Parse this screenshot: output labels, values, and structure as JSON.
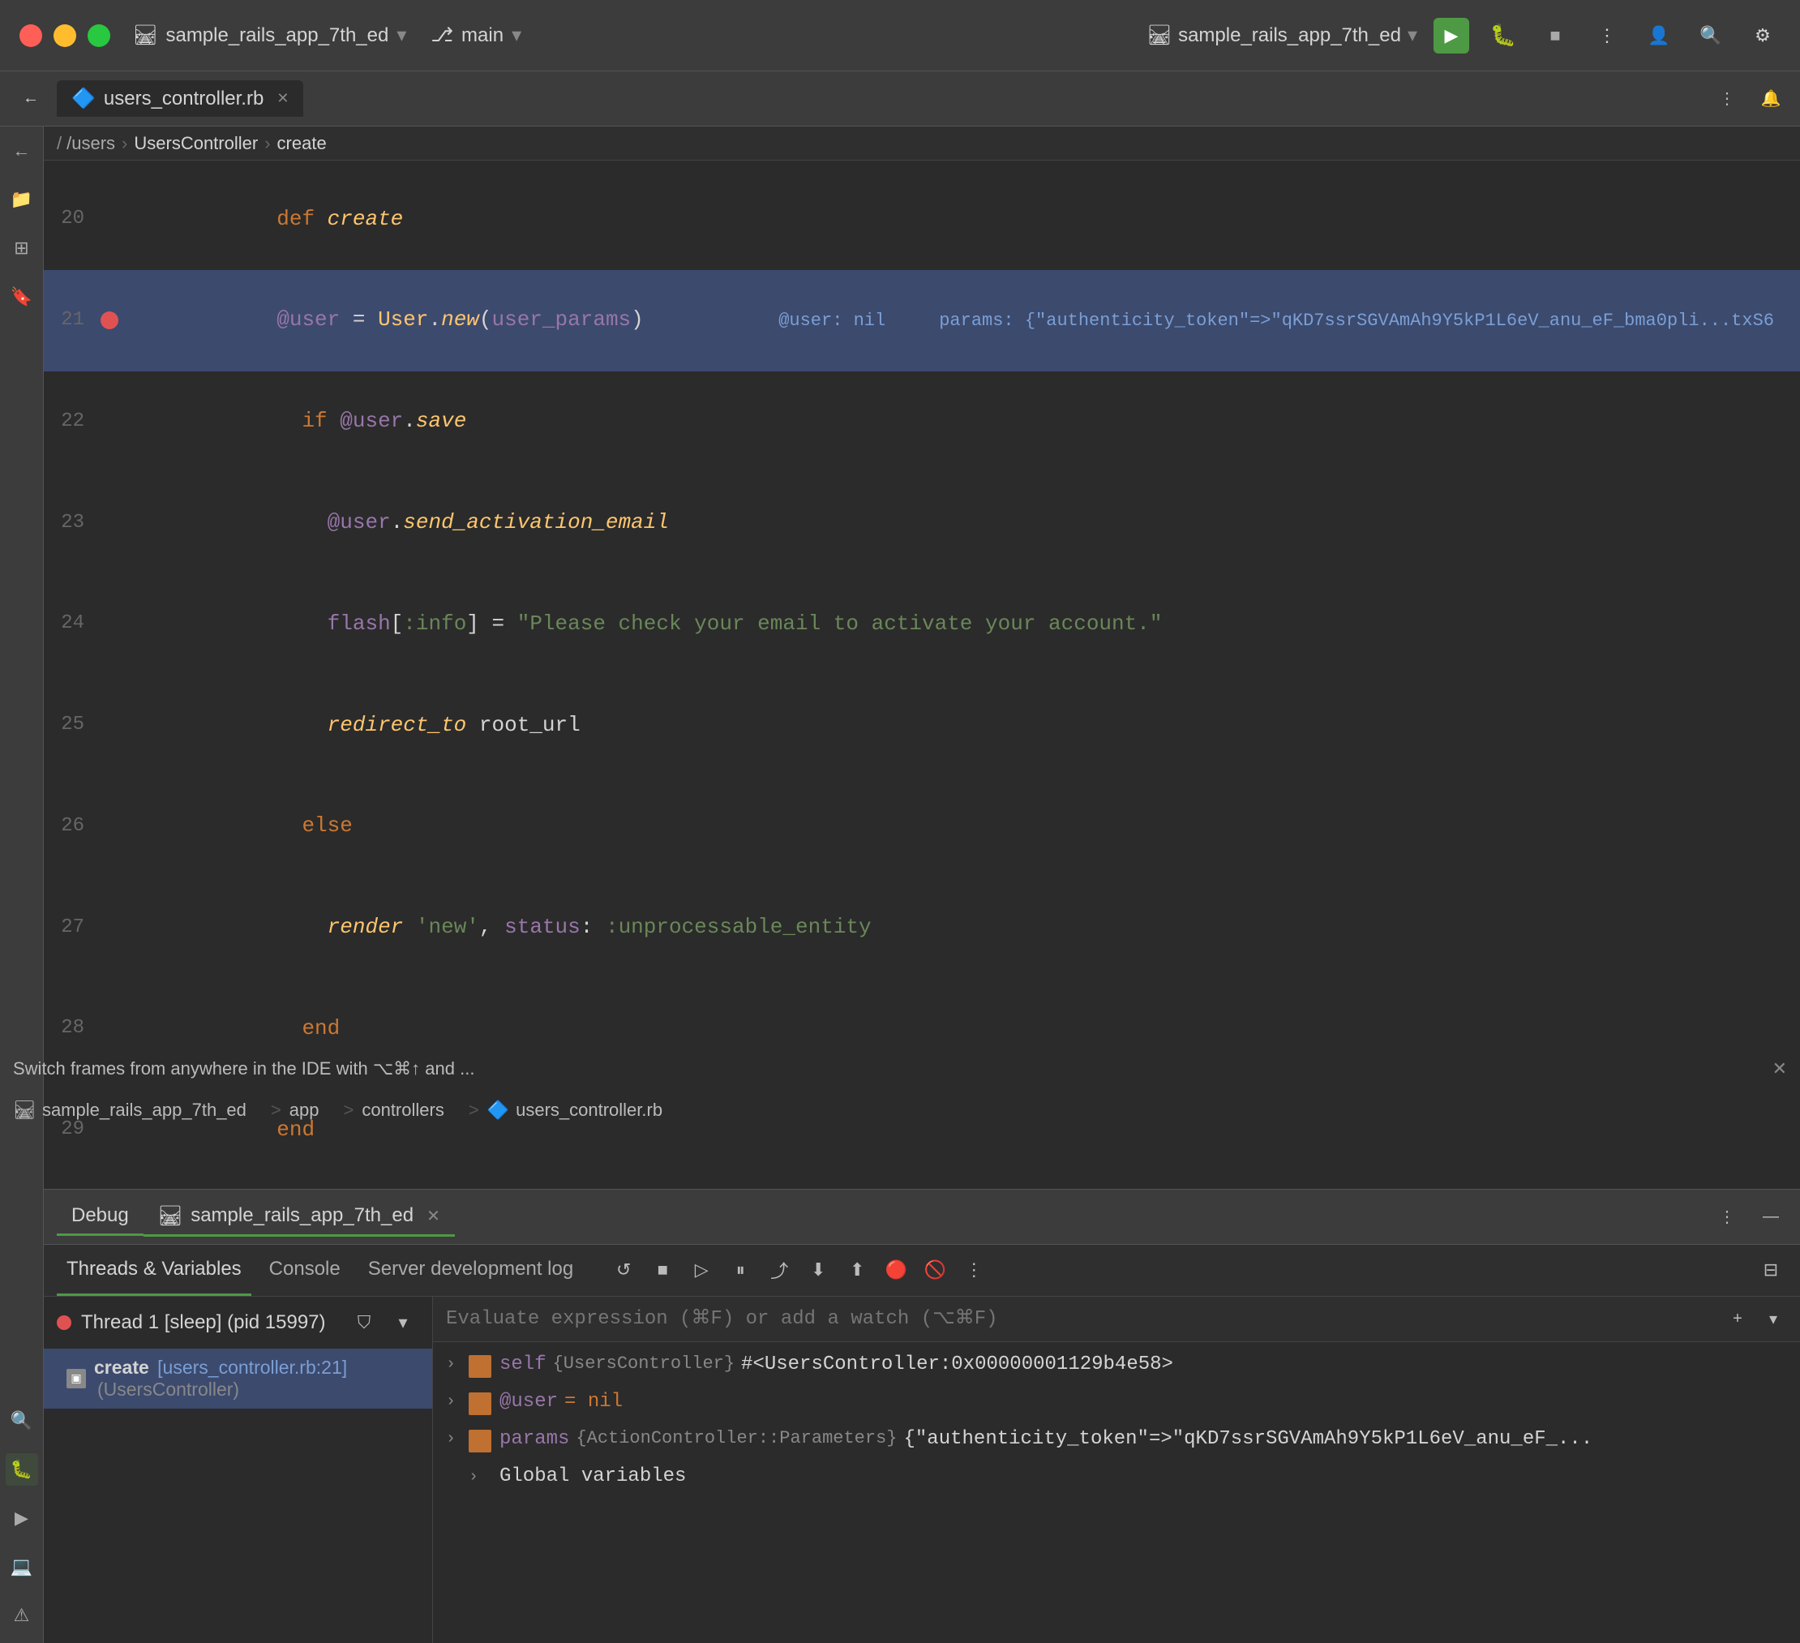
{
  "titlebar": {
    "project_name": "sample_rails_app_7th_ed",
    "branch": "main",
    "project_name_right": "sample_rails_app_7th_ed",
    "run_icon": "▶",
    "stop_icon": "■",
    "more_icon": "⋮",
    "user_icon": "👤",
    "search_icon": "🔍",
    "settings_icon": "⚙"
  },
  "tabs": [
    {
      "label": "users_controller.rb",
      "active": true,
      "closeable": true
    }
  ],
  "breadcrumb": {
    "path": "/users",
    "class": "UsersController",
    "method": "create"
  },
  "code_lines": [
    {
      "num": "20",
      "content": "def create",
      "breakpoint": false,
      "highlighted": false
    },
    {
      "num": "21",
      "content": "  @user = User.new(user_params)",
      "breakpoint": true,
      "highlighted": true,
      "debug_text": "@user: nil    params: {\"authenticity_token\"=>\"qKD7ssrSGVAmAh9Y5kP1L6eV_anu_eF_bma0pli...txS6"
    },
    {
      "num": "22",
      "content": "  if @user.save",
      "breakpoint": false,
      "highlighted": false
    },
    {
      "num": "23",
      "content": "    @user.send_activation_email",
      "breakpoint": false,
      "highlighted": false
    },
    {
      "num": "24",
      "content": "    flash[:info] = \"Please check your email to activate your account.\"",
      "breakpoint": false,
      "highlighted": false
    },
    {
      "num": "25",
      "content": "    redirect_to root_url",
      "breakpoint": false,
      "highlighted": false
    },
    {
      "num": "26",
      "content": "  else",
      "breakpoint": false,
      "highlighted": false
    },
    {
      "num": "27",
      "content": "    render 'new', status: :unprocessable_entity",
      "breakpoint": false,
      "highlighted": false
    },
    {
      "num": "28",
      "content": "  end",
      "breakpoint": false,
      "highlighted": false
    },
    {
      "num": "29",
      "content": "end",
      "breakpoint": false,
      "highlighted": false
    }
  ],
  "debug": {
    "tab_debug": "Debug",
    "tab_project": "sample_rails_app_7th_ed",
    "toolbar_buttons": [
      "↺",
      "■",
      "▷",
      "⏸",
      "⬆",
      "⬇",
      "⬆",
      "🔴",
      "🚫",
      "⋮"
    ],
    "threads_label": "Threads & Variables",
    "console_label": "Console",
    "server_log_label": "Server development log",
    "thread1": {
      "label": "Thread 1 [sleep] (pid 15997)"
    },
    "frame1": {
      "label": "create",
      "file": "[users_controller.rb:21]",
      "class": "(UsersController)"
    },
    "expression_placeholder": "Evaluate expression (⌘F) or add a watch (⌥⌘F)",
    "variables": [
      {
        "expand": true,
        "name": "self",
        "type": "{UsersController}",
        "value": "#<UsersController:0x00000001129b4e58>"
      },
      {
        "expand": true,
        "name": "@user",
        "type": null,
        "value": "= nil"
      },
      {
        "expand": true,
        "name": "params",
        "type": "{ActionController::Parameters}",
        "value": "{\"authenticity_token\"=>\"qKD7ssrSGVAmAh9Y5kP1L6eV_anu_eF_..."
      },
      {
        "expand": false,
        "name": "Global variables",
        "type": null,
        "value": null
      }
    ]
  },
  "bottom_bar": {
    "project": "sample_rails_app_7th_ed",
    "separator": ">",
    "folder": "app",
    "sep2": ">",
    "subfolder": "controllers",
    "sep3": ">",
    "file": "users_controller.rb",
    "notification": "Switch frames from anywhere in the IDE with ⌥⌘↑ and ..."
  },
  "sidebar_icons": [
    "←",
    "📁",
    "🔲",
    "⚙",
    "⋯"
  ],
  "sidebar_icons_bottom": [
    "🔍",
    "📦",
    "▶",
    "🖥",
    "⚠"
  ]
}
